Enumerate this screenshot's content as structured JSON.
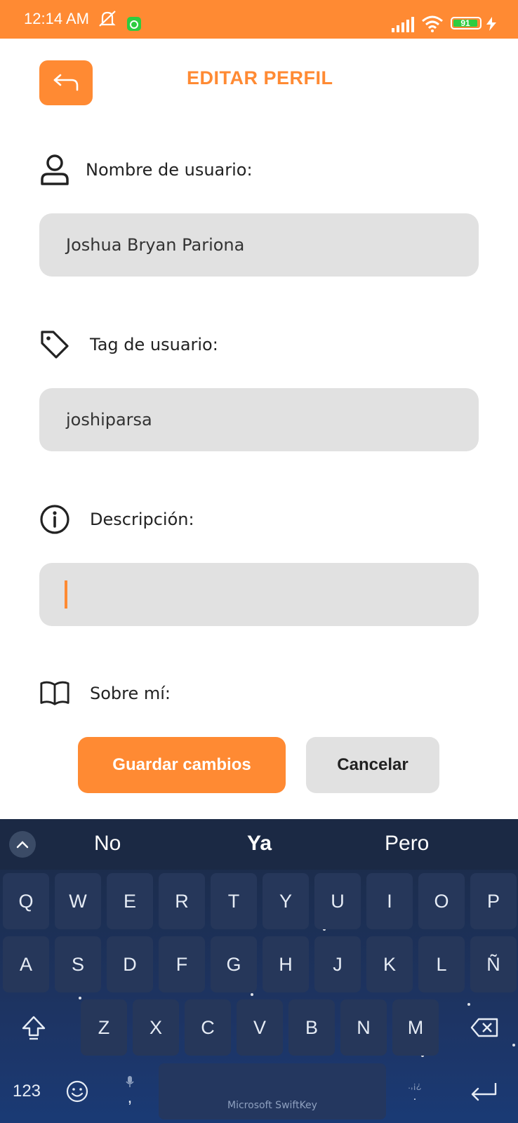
{
  "status_bar": {
    "time": "12:14 AM",
    "battery": "91",
    "icons": [
      "mute-icon",
      "app-notification-icon",
      "signal-icon",
      "wifi-icon",
      "battery-icon",
      "charging-icon"
    ]
  },
  "header": {
    "title": "EDITAR PERFIL",
    "back_icon": "back-arrow-icon"
  },
  "form": {
    "username": {
      "label": "Nombre de usuario:",
      "value": "Joshua Bryan Pariona",
      "icon": "user-icon"
    },
    "tag": {
      "label": "Tag de usuario:",
      "value": "joshiparsa",
      "icon": "tag-icon"
    },
    "description": {
      "label": "Descripción:",
      "value": "",
      "icon": "info-icon"
    },
    "about": {
      "label": "Sobre mí:",
      "icon": "book-icon"
    }
  },
  "actions": {
    "save_label": "Guardar cambios",
    "cancel_label": "Cancelar"
  },
  "colors": {
    "accent": "#ff8a33",
    "field_bg": "#e1e1e1",
    "keyboard_bg": "#1d3566"
  },
  "keyboard": {
    "suggestions": [
      "No",
      "Ya",
      "Pero"
    ],
    "row1": [
      "Q",
      "W",
      "E",
      "R",
      "T",
      "Y",
      "U",
      "I",
      "O",
      "P"
    ],
    "row2": [
      "A",
      "S",
      "D",
      "F",
      "G",
      "H",
      "J",
      "K",
      "L",
      "Ñ"
    ],
    "row3": [
      "Z",
      "X",
      "C",
      "V",
      "B",
      "N",
      "M"
    ],
    "numbers_label": "123",
    "comma": ",",
    "period": ".",
    "punct_hint": ".,¡¿",
    "space_label": "Microsoft SwiftKey"
  }
}
